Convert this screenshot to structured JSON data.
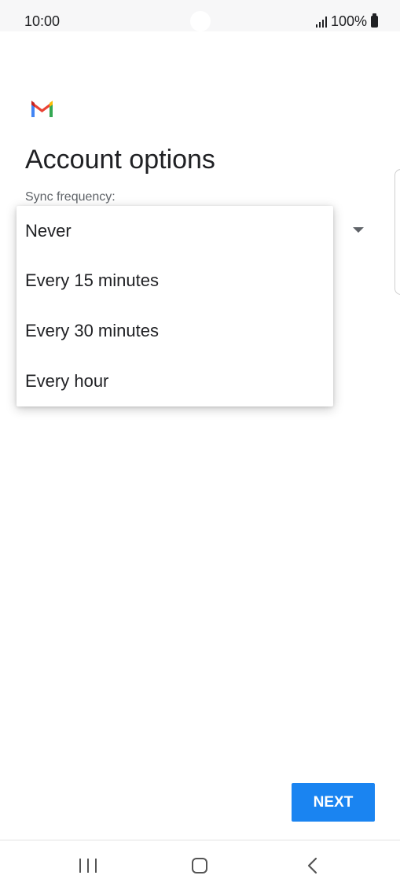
{
  "status_bar": {
    "time": "10:00",
    "battery_text": "100%"
  },
  "screen": {
    "title": "Account options",
    "sync_label": "Sync frequency:"
  },
  "dropdown": {
    "options": [
      "Never",
      "Every 15 minutes",
      "Every 30 minutes",
      "Every hour"
    ]
  },
  "actions": {
    "next_label": "NEXT"
  },
  "icons": {
    "app_logo": "gmail-icon",
    "signal": "signal-icon",
    "battery": "battery-icon",
    "dropdown": "dropdown-arrow-icon",
    "nav_recent": "recent-apps-icon",
    "nav_home": "home-icon",
    "nav_back": "back-icon"
  },
  "colors": {
    "primary_button": "#1a84f1",
    "text_primary": "#202124",
    "text_secondary": "#5f6368"
  }
}
